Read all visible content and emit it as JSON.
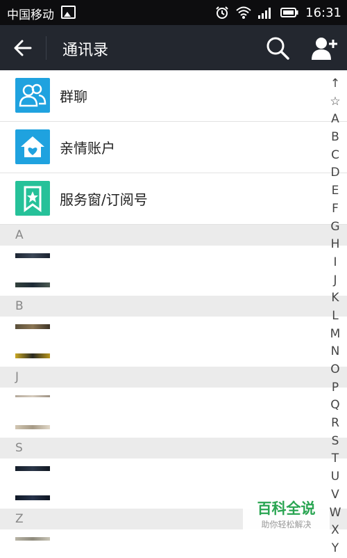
{
  "status_bar": {
    "carrier": "中国移动",
    "time": "16:31"
  },
  "app_bar": {
    "title": "通讯录"
  },
  "entries": [
    {
      "label": "群聊",
      "color": "#1fa2df"
    },
    {
      "label": "亲情账户",
      "color": "#1fa2df"
    },
    {
      "label": "服务窗/订阅号",
      "color": "#26c199"
    }
  ],
  "sections": [
    {
      "letter": "A"
    },
    {
      "letter": "B"
    },
    {
      "letter": "J"
    },
    {
      "letter": "S"
    },
    {
      "letter": "Z"
    }
  ],
  "index": [
    "↑",
    "☆",
    "A",
    "B",
    "C",
    "D",
    "E",
    "F",
    "G",
    "H",
    "I",
    "J",
    "K",
    "L",
    "M",
    "N",
    "O",
    "P",
    "Q",
    "R",
    "S",
    "T",
    "U",
    "V",
    "W",
    "X",
    "Y"
  ],
  "watermark": {
    "title": "百科全说",
    "subtitle": "助你轻松解决"
  }
}
